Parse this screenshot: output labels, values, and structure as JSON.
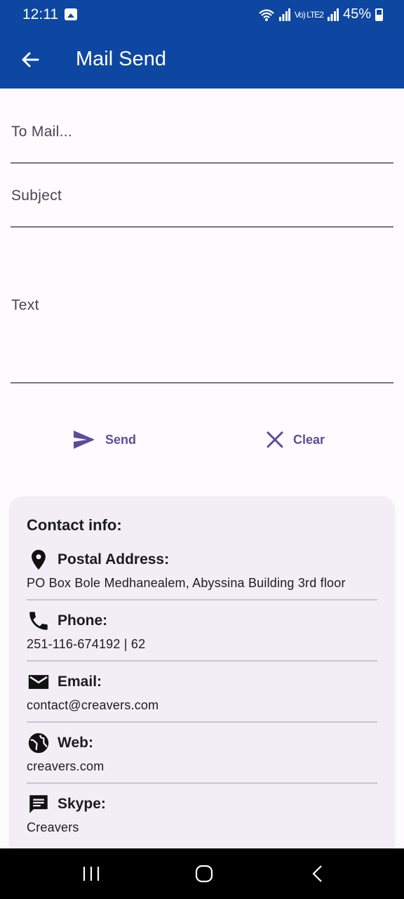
{
  "status_bar": {
    "time": "12:11",
    "battery": "45%",
    "network_label": "Vo) LTE2",
    "icons": [
      "image-icon",
      "wifi-icon",
      "signal-icon",
      "battery-icon"
    ]
  },
  "app_bar": {
    "title": "Mail Send",
    "background_color": "#0d47a1"
  },
  "form": {
    "to_placeholder": "To Mail...",
    "subject_placeholder": "Subject",
    "text_placeholder": "Text",
    "to_value": "",
    "subject_value": "",
    "text_value": ""
  },
  "actions": {
    "send_label": "Send",
    "clear_label": "Clear",
    "accent_color": "#5b4d9b"
  },
  "contact": {
    "heading": "Contact info:",
    "items": [
      {
        "label": "Postal Address:",
        "value": "PO Box Bole Medhanealem, Abyssina Building 3rd floor",
        "icon": "location-pin-icon"
      },
      {
        "label": "Phone:",
        "value": "251-116-674192 | 62",
        "icon": "phone-icon"
      },
      {
        "label": "Email:",
        "value": "contact@creavers.com",
        "icon": "email-icon"
      },
      {
        "label": "Web:",
        "value": "creavers.com",
        "icon": "globe-icon"
      },
      {
        "label": "Skype:",
        "value": "Creavers",
        "icon": "chat-icon"
      }
    ]
  },
  "nav_bar": {
    "icons": [
      "recent-apps-icon",
      "home-icon",
      "back-icon"
    ]
  }
}
